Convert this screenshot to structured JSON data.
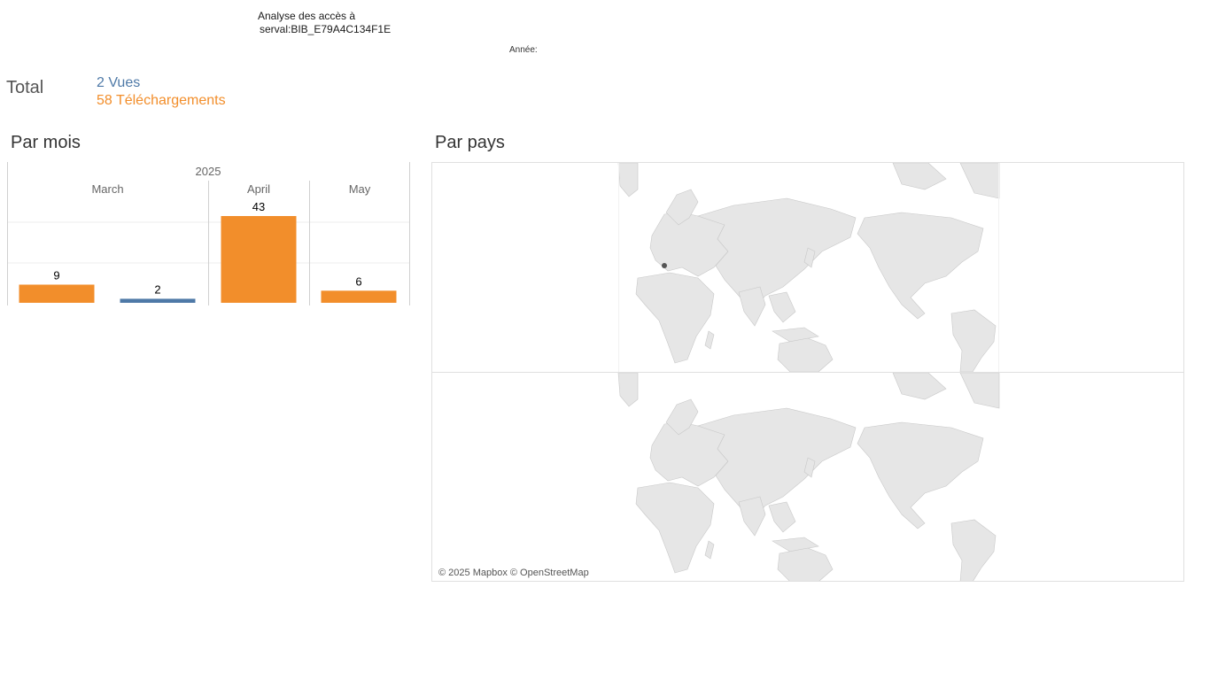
{
  "header": {
    "title_line1": "Analyse des accès à",
    "title_line2": "serval:BIB_E79A4C134F1E",
    "year_label": "Année:"
  },
  "totals": {
    "label": "Total",
    "views": "2 Vues",
    "downloads": "58 Téléchargements"
  },
  "sections": {
    "by_month": "Par mois",
    "by_country": "Par pays"
  },
  "colors": {
    "views": "#4e79a7",
    "downloads": "#f28e2b",
    "land": "#e6e6e6",
    "highlight_country": "#555555"
  },
  "chart_data": {
    "type": "bar",
    "year": "2025",
    "months": [
      "March",
      "April",
      "May"
    ],
    "bars": [
      {
        "month": "March",
        "series": "downloads",
        "value": 9
      },
      {
        "month": "March",
        "series": "views",
        "value": 2
      },
      {
        "month": "April",
        "series": "downloads",
        "value": 43
      },
      {
        "month": "May",
        "series": "downloads",
        "value": 6
      }
    ],
    "ylim": [
      0,
      43
    ],
    "grid": true,
    "legend": "none"
  },
  "map": {
    "attribution": "© 2025 Mapbox © OpenStreetMap",
    "highlighted_country": "Switzerland"
  }
}
